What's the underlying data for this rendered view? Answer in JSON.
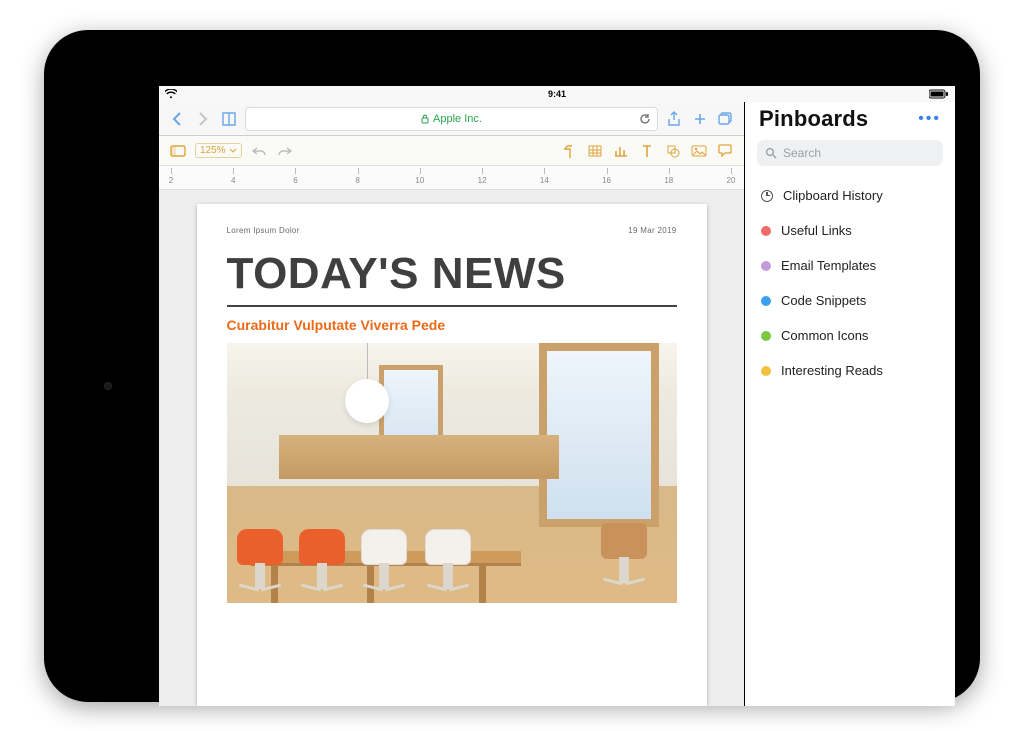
{
  "status": {
    "time": "9:41"
  },
  "safari": {
    "address_label": "Apple Inc.",
    "secure": true
  },
  "toolbar": {
    "zoom": "125%"
  },
  "ruler": {
    "start": 2,
    "end": 20,
    "step": 2
  },
  "document": {
    "meta_left": "Lorem Ipsum Dolor",
    "meta_right": "19 Mar 2019",
    "headline": "TODAY'S NEWS",
    "subhead": "Curabitur Vulputate Viverra Pede"
  },
  "pinboards": {
    "title": "Pinboards",
    "search_placeholder": "Search",
    "items": [
      {
        "kind": "clock",
        "label": "Clipboard History"
      },
      {
        "kind": "dot",
        "color": "#ef6a6a",
        "label": "Useful Links"
      },
      {
        "kind": "dot",
        "color": "#c49bd8",
        "label": "Email Templates"
      },
      {
        "kind": "dot",
        "color": "#3aa0ef",
        "label": "Code Snippets"
      },
      {
        "kind": "dot",
        "color": "#7ac943",
        "label": "Common Icons"
      },
      {
        "kind": "dot",
        "color": "#f2c23e",
        "label": "Interesting Reads"
      }
    ]
  }
}
